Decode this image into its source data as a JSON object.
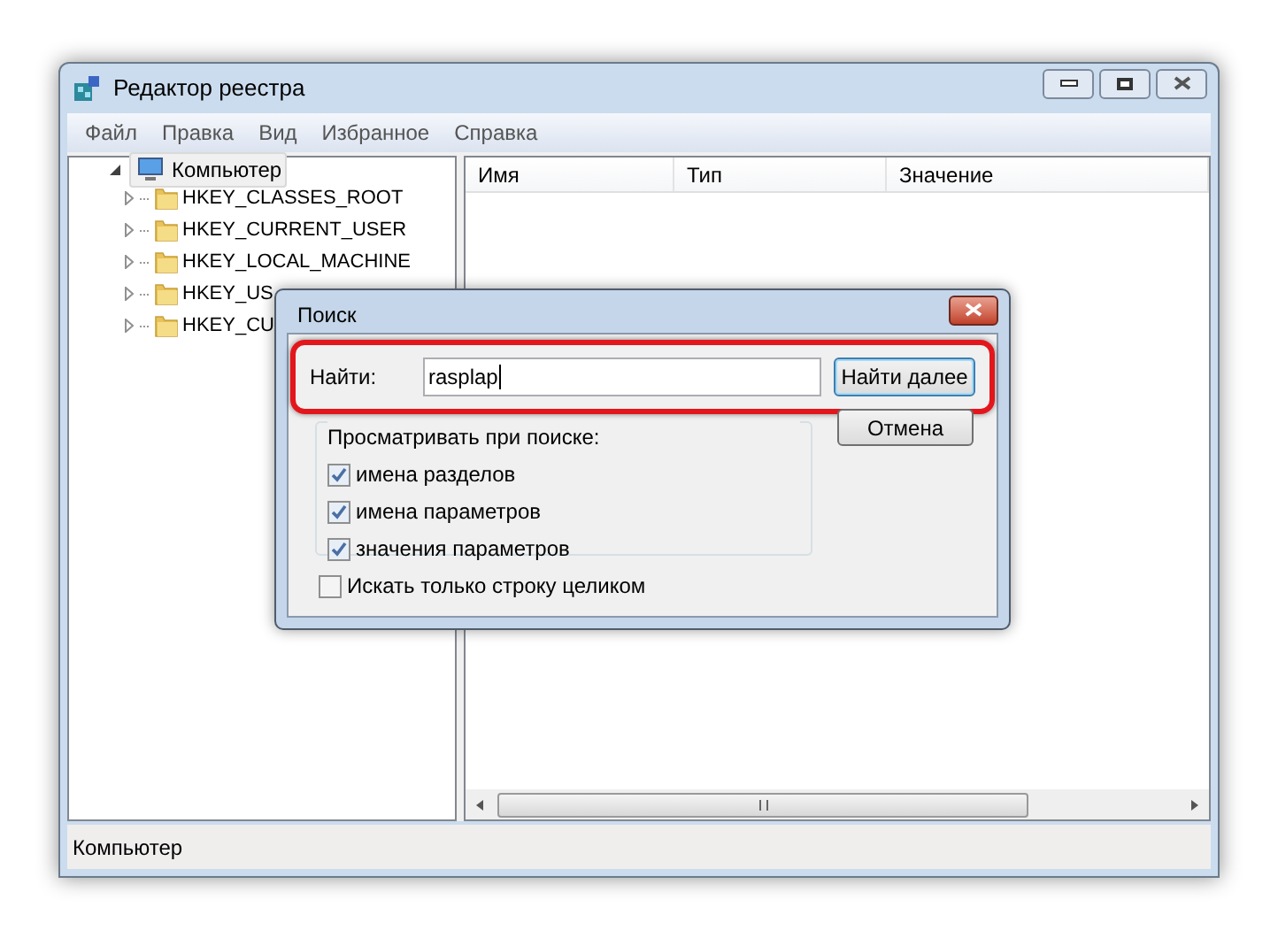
{
  "window": {
    "title": "Редактор реестра"
  },
  "menu": [
    "Файл",
    "Правка",
    "Вид",
    "Избранное",
    "Справка"
  ],
  "tree": {
    "label": "Компьютер",
    "expanded": true,
    "selected": true,
    "children": [
      {
        "label": "HKEY_CLASSES_ROOT",
        "expanded": false,
        "selected": false
      },
      {
        "label": "HKEY_CURRENT_USER",
        "expanded": false,
        "selected": false
      },
      {
        "label": "HKEY_LOCAL_MACHINE",
        "expanded": false,
        "selected": false
      },
      {
        "label": "HKEY_US",
        "expanded": false,
        "selected": false
      },
      {
        "label": "HKEY_CU",
        "expanded": false,
        "selected": false
      }
    ]
  },
  "table": {
    "columns": [
      "Имя",
      "Тип",
      "Значение"
    ]
  },
  "status_bar": "Компьютер",
  "dialog": {
    "title": "Поиск",
    "find_label": "Найти:",
    "find_value": "rasplap",
    "highlighted": true,
    "buttons": [
      {
        "label": "Найти далее",
        "default": true
      },
      {
        "label": "Отмена",
        "default": false
      }
    ],
    "group_label": "Просматривать при поиске:",
    "options": [
      {
        "label": "имена разделов",
        "checked": true
      },
      {
        "label": "имена параметров",
        "checked": true
      },
      {
        "label": "значения параметров",
        "checked": true
      }
    ],
    "whole_string": {
      "label": "Искать только строку целиком",
      "checked": false
    }
  }
}
